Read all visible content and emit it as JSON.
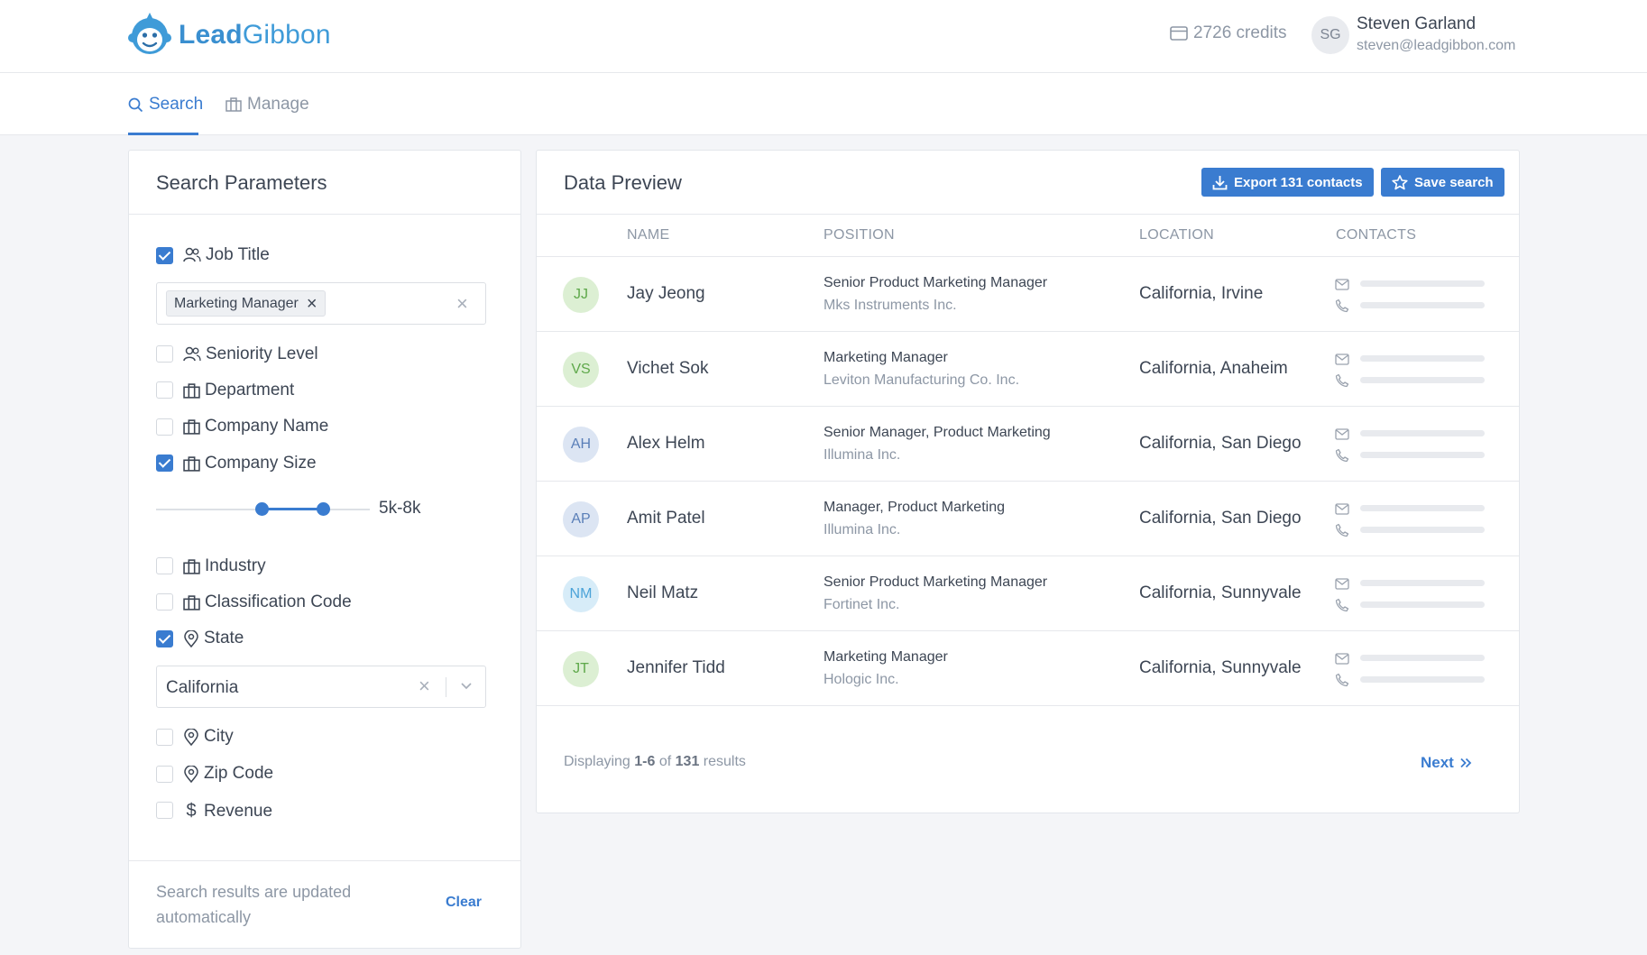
{
  "brand": {
    "name_bold": "Lead",
    "name_rest": "Gibbon"
  },
  "header": {
    "credits": "2726 credits",
    "user_initials": "SG",
    "user_name": "Steven Garland",
    "user_email": "steven@leadgibbon.com"
  },
  "nav": {
    "search_label": "Search",
    "manage_label": "Manage"
  },
  "search_panel": {
    "title": "Search Parameters",
    "job_title": {
      "label": "Job Title",
      "checked": true,
      "tag": "Marketing Manager"
    },
    "seniority": {
      "label": "Seniority Level",
      "checked": false
    },
    "department": {
      "label": "Department",
      "checked": false
    },
    "company_name": {
      "label": "Company Name",
      "checked": false
    },
    "company_size": {
      "label": "Company Size",
      "checked": true,
      "range_label": "5k-8k"
    },
    "industry": {
      "label": "Industry",
      "checked": false
    },
    "classification": {
      "label": "Classification Code",
      "checked": false
    },
    "state": {
      "label": "State",
      "checked": true,
      "value": "California"
    },
    "city": {
      "label": "City",
      "checked": false
    },
    "zip": {
      "label": "Zip Code",
      "checked": false
    },
    "revenue": {
      "label": "Revenue",
      "checked": false
    },
    "footer_note": "Search results are updated automatically",
    "clear_label": "Clear"
  },
  "preview": {
    "title": "Data Preview",
    "export_label": "Export 131 contacts",
    "save_label": "Save search",
    "columns": [
      "NAME",
      "POSITION",
      "LOCATION",
      "CONTACTS"
    ],
    "rows": [
      {
        "initials": "JJ",
        "name": "Jay Jeong",
        "position": "Senior Product Marketing Manager",
        "company": "Mks Instruments Inc.",
        "location": "California, Irvine",
        "avatar_bg": "#dcefd3",
        "avatar_fg": "#5ea84a"
      },
      {
        "initials": "VS",
        "name": "Vichet Sok",
        "position": "Marketing Manager",
        "company": "Leviton Manufacturing Co. Inc.",
        "location": "California, Anaheim",
        "avatar_bg": "#dcefd3",
        "avatar_fg": "#5ea84a"
      },
      {
        "initials": "AH",
        "name": "Alex Helm",
        "position": "Senior Manager, Product Marketing",
        "company": "Illumina Inc.",
        "location": "California, San Diego",
        "avatar_bg": "#dce5f3",
        "avatar_fg": "#5a7fb8"
      },
      {
        "initials": "AP",
        "name": "Amit Patel",
        "position": "Manager, Product Marketing",
        "company": "Illumina Inc.",
        "location": "California, San Diego",
        "avatar_bg": "#dce5f3",
        "avatar_fg": "#5a7fb8"
      },
      {
        "initials": "NM",
        "name": "Neil Matz",
        "position": "Senior Product Marketing Manager",
        "company": "Fortinet Inc.",
        "location": "California, Sunnyvale",
        "avatar_bg": "#d7ecf8",
        "avatar_fg": "#4ba3d8"
      },
      {
        "initials": "JT",
        "name": "Jennifer Tidd",
        "position": "Marketing Manager",
        "company": "Hologic Inc.",
        "location": "California, Sunnyvale",
        "avatar_bg": "#dcefd3",
        "avatar_fg": "#5ea84a"
      }
    ],
    "results": {
      "prefix": "Displaying",
      "range": "1-6",
      "of": "of",
      "total": "131",
      "suffix": "results"
    },
    "next_label": "Next"
  },
  "colors": {
    "accent": "#3a7cd0",
    "brand_blue": "#3f9bd8"
  }
}
